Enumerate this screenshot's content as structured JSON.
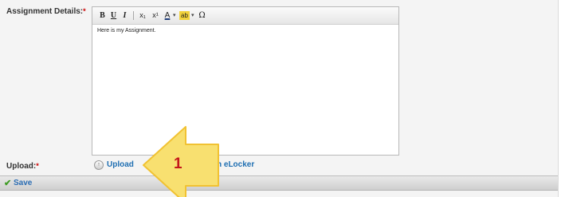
{
  "form": {
    "details_label": "Assignment Details:",
    "details_required": "*",
    "editor_content": "Here is my Assignment.",
    "upload_label": "Upload:",
    "upload_required": "*",
    "upload_link": "Upload",
    "elocker_link": "n eLocker"
  },
  "toolbar": {
    "bold": "B",
    "underline": "U",
    "italic": "I",
    "subscript": "x₁",
    "superscript": "x¹",
    "font_color": "A",
    "highlight": "ab",
    "dropdown_glyph": "▾",
    "special_char": "Ω"
  },
  "savebar": {
    "save_label": "Save"
  },
  "callout": {
    "number": "1",
    "fill_color": "#f8e070",
    "border_color": "#f1c232",
    "number_color": "#c4171b"
  },
  "colors": {
    "link": "#1f6fb2",
    "required": "#cc0000",
    "save_check": "#3e9b24"
  }
}
